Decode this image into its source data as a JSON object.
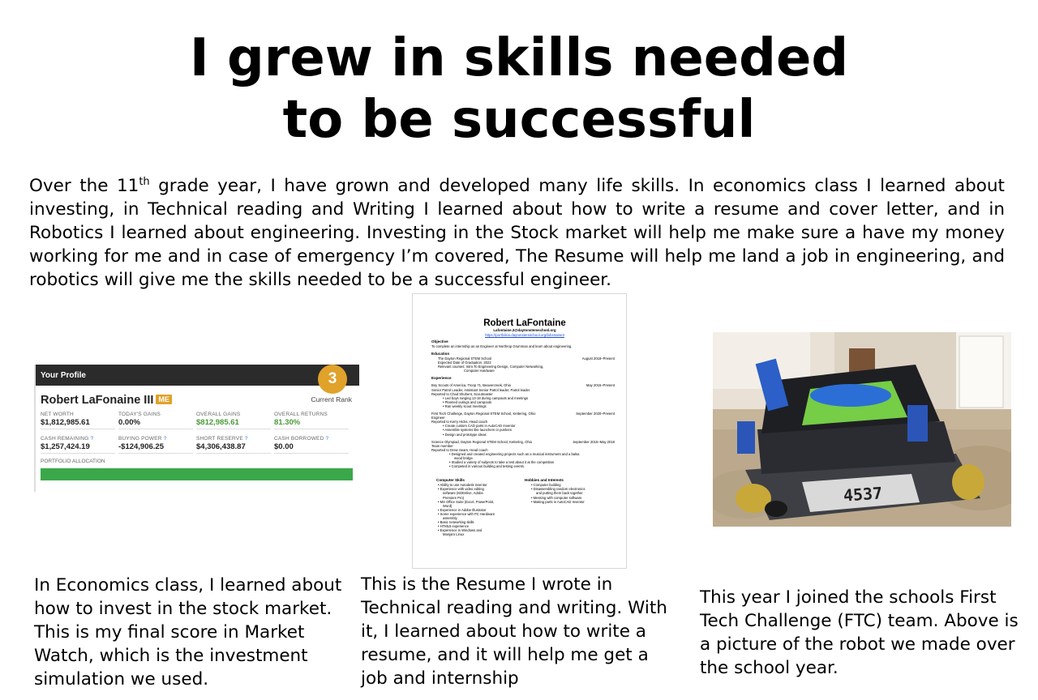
{
  "title": {
    "line1": "I grew in skills needed",
    "line2": "to be successful"
  },
  "intro": {
    "before_sup": "Over the 11",
    "sup": "th",
    "after_sup": " grade year, I have grown and developed many life skills. In economics class I learned about investing, in Technical reading and Writing I learned about how to write a resume and cover letter, and in Robotics I learned about engineering. Investing in the Stock market will help me make sure a have my money working for me and in case of emergency I’m covered, The Resume will help me land a job in engineering, and robotics will give me the skills needed to be a successful engineer."
  },
  "profile": {
    "header": "Your Profile",
    "rank": "3",
    "rank_label": "Current Rank",
    "name": "Robert LaFonaine III",
    "badge": "ME",
    "stats": [
      {
        "label": "NET WORTH",
        "value": "$1,812,985.61"
      },
      {
        "label": "TODAY'S GAINS",
        "value": "0.00%"
      },
      {
        "label": "OVERALL GAINS",
        "value": "$812,985.61"
      },
      {
        "label": "OVERALL RETURNS",
        "value": "81.30%"
      },
      {
        "label": "CASH REMAINING",
        "value": "$1,257,424.19"
      },
      {
        "label": "BUYING POWER",
        "value": "-$124,906.25"
      },
      {
        "label": "SHORT RESERVE",
        "value": "$4,306,438.87"
      },
      {
        "label": "CASH BORROWED",
        "value": "$0.00"
      }
    ],
    "help_mark": "?",
    "allocation_label": "PORTFOLIO ALLOCATION",
    "accent": "#e0a22a",
    "gain_color": "#4a9a3a",
    "bar_color": "#3aa84a"
  },
  "resume": {
    "name": "Robert LaFontaine",
    "email": "Lafontaine.3@daytonstemschool.org",
    "link": "https://portfolios.daytonstemschool.org/lafontaine3",
    "objective_h": "Objective",
    "objective": "To complete an internship as an Engineer at Northrop Grumman and learn about engineering.",
    "education_h": "Education",
    "edu_school": "The Dayton Regional STEM School",
    "edu_dates": "August 2018–Present",
    "edu_grad": "Expected Date of Graduation: 2022",
    "edu_courses": "Relevant courses: Intro To Engineering Design, Computer Networking,",
    "edu_courses2": "Computer Hardware",
    "experience_h": "Experience",
    "exp1_org": "Boy Scouts of America, Troop 71, Beavercreek, Ohio",
    "exp1_dates": "May 2015–Present",
    "exp1_role": "Senior Patrol Leader, Assistant Senior Patrol leader, Patrol leader",
    "exp1_report": "Reported to Chad Shuhent, Scoutmaster",
    "exp1_b1": "Led boys ranging 13-18 during campouts and meetings",
    "exp1_b2": "Planned outings and campouts",
    "exp1_b3": "Ran weekly scout meetings",
    "exp2_org": "First Tech Challenge, Dayton Regional STEM School, Kettering, Ohio",
    "exp2_dates": "September 2020–Present",
    "exp2_role": "Engineer",
    "exp2_report": "Reported to Kerry Hicks, Head coach",
    "exp2_b1": "Create custom CAD parts in AutoCAD Inventor",
    "exp2_b2": "Assemble systems like launchers or pushers",
    "exp2_b3": "Design and prototype ideas",
    "exp3_org": "Science Olympiad, Dayton Regional STEM School, Kettering, Ohio",
    "exp3_dates": "September 2015–May 2018",
    "exp3_role": "Team member",
    "exp3_report": "Reported to Drew Sears, Head coach",
    "exp3_b1": "Designed and created engineering projects such as a musical instrument and a balsa",
    "exp3_b1b": "wood bridge.",
    "exp3_b2": "Studied a variety of subjects to take a test about it at the competition",
    "exp3_b3": "Competed in various building and testing events.",
    "skills_h": "Computer Skills",
    "skills": [
      "Ability to use Autodesk inventor",
      "Experience with video editing",
      "software (KDEnlive, Adobe",
      "Premiere Pro)",
      "MS Office Suite (Excel, PowerPoint,",
      "Word)",
      "Experience in Adobe Illustrator",
      "Some experience with PC Hardware",
      "assembly",
      "Basic networking skills",
      "HTML5 experience",
      "Experience in Windows and",
      "Manjaro Linux"
    ],
    "hobbies_h": "Hobbies and Interests",
    "hobbies": [
      "Computer building",
      "Disassembling random electronics",
      "and putting them back together",
      "Messing with computer software",
      "Making parts in AutoCAD Inventor"
    ]
  },
  "robot_number": "4537",
  "captions": {
    "econ": "In Economics class, I learned about how to invest in the stock market. This is my final score in Market Watch, which is the investment simulation we used.",
    "resume": "This is the Resume I wrote in Technical reading and writing. With it, I learned about how to write a resume, and it will help me get a job and internship",
    "ftc": "This year I joined the schools First Tech Challenge (FTC) team. Above is a picture of the robot we made over the school year."
  }
}
